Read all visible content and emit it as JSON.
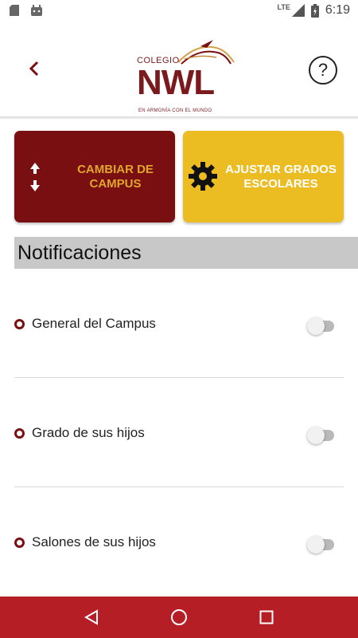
{
  "status_bar": {
    "time": "6:19",
    "network": "LTE"
  },
  "header": {
    "logo_small": "COLEGIO",
    "logo_big": "NWL",
    "logo_tagline": "EN ARMONÍA CON EL MUNDO",
    "help_symbol": "?"
  },
  "actions": {
    "campus_label": "CAMBIAR DE CAMPUS",
    "grados_label": "AJUSTAR GRADOS ESCOLARES"
  },
  "notifications": {
    "title": "Notificaciones",
    "items": [
      {
        "label": "General del Campus",
        "enabled": false
      },
      {
        "label": "Grado de sus hijos",
        "enabled": false
      },
      {
        "label": "Salones de sus hijos",
        "enabled": false
      }
    ]
  },
  "colors": {
    "brand": "#7a0f12",
    "accent": "#ebbd23",
    "nav": "#b61e25"
  }
}
